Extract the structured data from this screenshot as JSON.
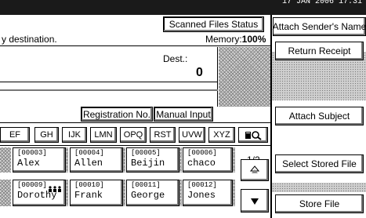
{
  "header": {
    "datetime": "17 JAN 2006 17:31"
  },
  "status": {
    "scanned_files_status": "Scanned Files Status",
    "destination_text": "y destination.",
    "memory_label": "Memory:",
    "memory_value": "100%"
  },
  "dest": {
    "label": "Dest.:",
    "count": "0"
  },
  "mode_buttons": {
    "registration_no": "Registration No.",
    "manual_input": "Manual Input"
  },
  "index_tabs": [
    "EF",
    "GH",
    "IJK",
    "LMN",
    "OPQ",
    "RST",
    "UVW",
    "XYZ"
  ],
  "search_icon": "book-search-icon",
  "page_indicator": "1/2",
  "entries": [
    {
      "number": "[00003]",
      "name": "Alex",
      "group": ""
    },
    {
      "number": "[00004]",
      "name": "Allen",
      "group": ""
    },
    {
      "number": "[00005]",
      "name": "Beijin",
      "group": ""
    },
    {
      "number": "[00006]",
      "name": "chaco",
      "group": ""
    },
    {
      "number": "[00009]",
      "name": "Dorothy",
      "group": "group-icon"
    },
    {
      "number": "[00010]",
      "name": "Frank",
      "group": ""
    },
    {
      "number": "[00011]",
      "name": "George",
      "group": ""
    },
    {
      "number": "[00012]",
      "name": "Jones",
      "group": ""
    }
  ],
  "right_panel": {
    "attach_senders_name": "Attach Sender's Name",
    "return_receipt": "Return Receipt",
    "attach_subject": "Attach Subject",
    "select_stored_file": "Select Stored File",
    "store_file": "Store File"
  },
  "scroll": {
    "up_icon": "scroll-up-icon",
    "down_icon": "scroll-down-icon"
  }
}
